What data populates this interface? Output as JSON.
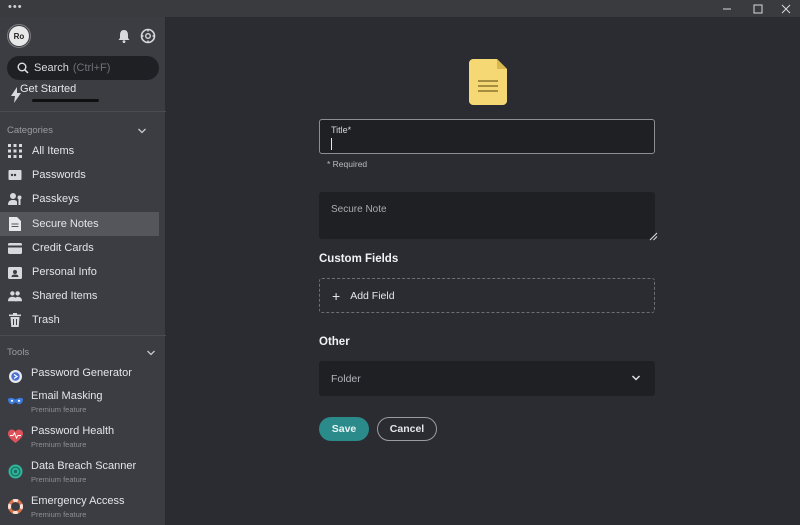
{
  "window": {
    "menu_glyph": "•••",
    "controls": [
      {
        "name": "minimize-icon",
        "glyph": "—"
      },
      {
        "name": "maximize-icon",
        "glyph": "☐"
      },
      {
        "name": "close-icon",
        "glyph": "✕"
      }
    ]
  },
  "sidebar": {
    "avatar_initials": "Ro",
    "header_icons": [
      "bell-icon",
      "settings-icon"
    ],
    "search": {
      "label": "Search",
      "shortcut": "(Ctrl+F)"
    },
    "get_started": {
      "label": "Get Started",
      "icon": "lightning-icon"
    },
    "categories_label": "Categories",
    "categories": [
      {
        "label": "All Items",
        "icon": "grid-icon",
        "active": false
      },
      {
        "label": "Passwords",
        "icon": "password-icon",
        "active": false
      },
      {
        "label": "Passkeys",
        "icon": "passkey-icon",
        "active": false
      },
      {
        "label": "Secure Notes",
        "icon": "note-icon",
        "active": true
      },
      {
        "label": "Credit Cards",
        "icon": "credit-card-icon",
        "active": false
      },
      {
        "label": "Personal Info",
        "icon": "id-card-icon",
        "active": false
      },
      {
        "label": "Shared Items",
        "icon": "users-icon",
        "active": false
      },
      {
        "label": "Trash",
        "icon": "trash-icon",
        "active": false
      }
    ],
    "tools_label": "Tools",
    "tools": [
      {
        "label": "Password Generator",
        "sub": "",
        "icon": "generator-icon",
        "color": "#4a6fd4"
      },
      {
        "label": "Email Masking",
        "sub": "Premium feature",
        "icon": "mask-icon",
        "color": "#3d7be0"
      },
      {
        "label": "Password Health",
        "sub": "Premium feature",
        "icon": "health-icon",
        "color": "#e0525a"
      },
      {
        "label": "Data Breach Scanner",
        "sub": "Premium feature",
        "icon": "radar-icon",
        "color": "#2fb39a"
      },
      {
        "label": "Emergency Access",
        "sub": "Premium feature",
        "icon": "lifebuoy-icon",
        "color": "#e0724a"
      }
    ]
  },
  "form": {
    "title_label": "Title*",
    "required_note": "* Required",
    "note_placeholder": "Secure Note",
    "custom_fields_heading": "Custom Fields",
    "add_field_label": "Add Field",
    "other_heading": "Other",
    "folder_label": "Folder",
    "save_label": "Save",
    "cancel_label": "Cancel"
  },
  "colors": {
    "accent": "#2b8a8a",
    "sidebar_bg": "#3b3d42",
    "main_bg": "#2a2c31",
    "field_bg": "#1f2024",
    "note_icon": "#f5d874"
  }
}
